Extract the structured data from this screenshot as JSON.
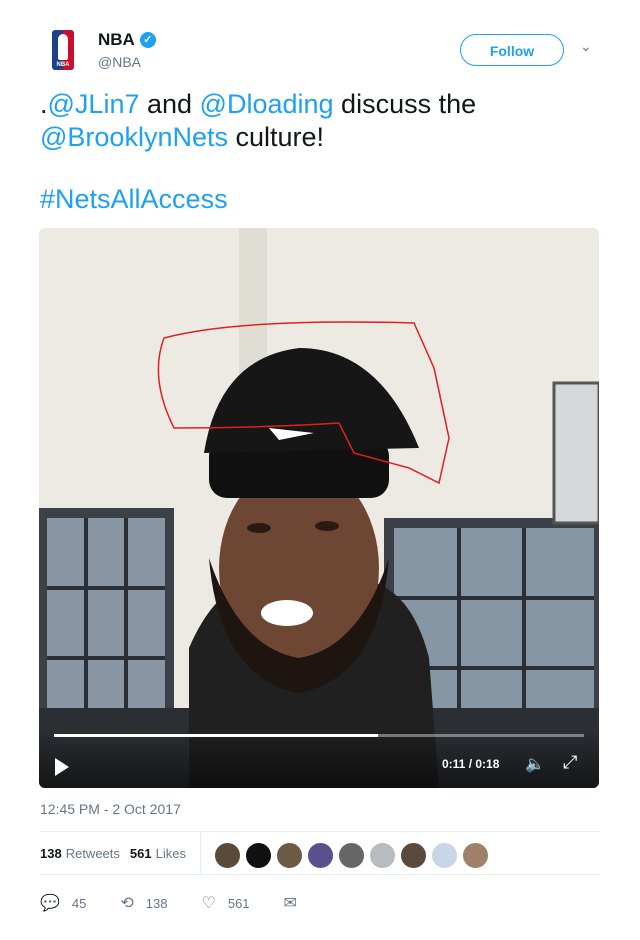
{
  "tweet": {
    "user": {
      "name": "NBA",
      "handle": "@NBA",
      "logo_text": "NBA"
    },
    "follow_label": "Follow",
    "text_parts": [
      ".",
      "@JLin7",
      " and ",
      "@Dloading",
      " discuss the ",
      "@BrooklynNets",
      " culture!"
    ],
    "hashtag": "#NetsAllAccess",
    "video": {
      "time": "0:11 / 0:18",
      "progress": 0.611
    },
    "timestamp": "12:45 PM - 2 Oct 2017",
    "retweets": {
      "count": "138",
      "label": "Retweets"
    },
    "likes": {
      "count": "561",
      "label": "Likes"
    },
    "actions": {
      "replies": "45",
      "retweets": "138",
      "likes": "561"
    }
  },
  "colors": {
    "accent": "#1da1f2",
    "text": "#14171a",
    "muted": "#657786"
  },
  "icons": [
    "verified-icon",
    "chevron-down-icon",
    "play-icon",
    "volume-icon",
    "fullscreen-icon",
    "reply-icon",
    "retweet-icon",
    "heart-icon",
    "mail-icon"
  ]
}
